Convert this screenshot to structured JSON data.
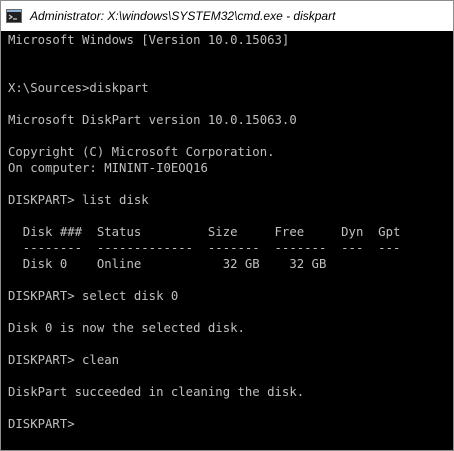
{
  "window": {
    "title": "Administrator: X:\\windows\\SYSTEM32\\cmd.exe - diskpart",
    "icon": "cmd-icon"
  },
  "console": {
    "lines": [
      "Microsoft Windows [Version 10.0.15063]",
      "X:\\Sources>diskpart",
      "Microsoft DiskPart version 10.0.15063.0",
      "Copyright (C) Microsoft Corporation.",
      "On computer: MININT-I0EOQ16",
      "DISKPART> list disk",
      "  Disk ###  Status         Size     Free     Dyn  Gpt",
      "  --------  -------------  -------  -------  ---  ---",
      "  Disk 0    Online           32 GB    32 GB",
      "DISKPART> select disk 0",
      "Disk 0 is now the selected disk.",
      "DISKPART> clean",
      "DiskPart succeeded in cleaning the disk.",
      "DISKPART>"
    ]
  },
  "colors": {
    "background": "#000000",
    "text": "#c0c0c0"
  }
}
